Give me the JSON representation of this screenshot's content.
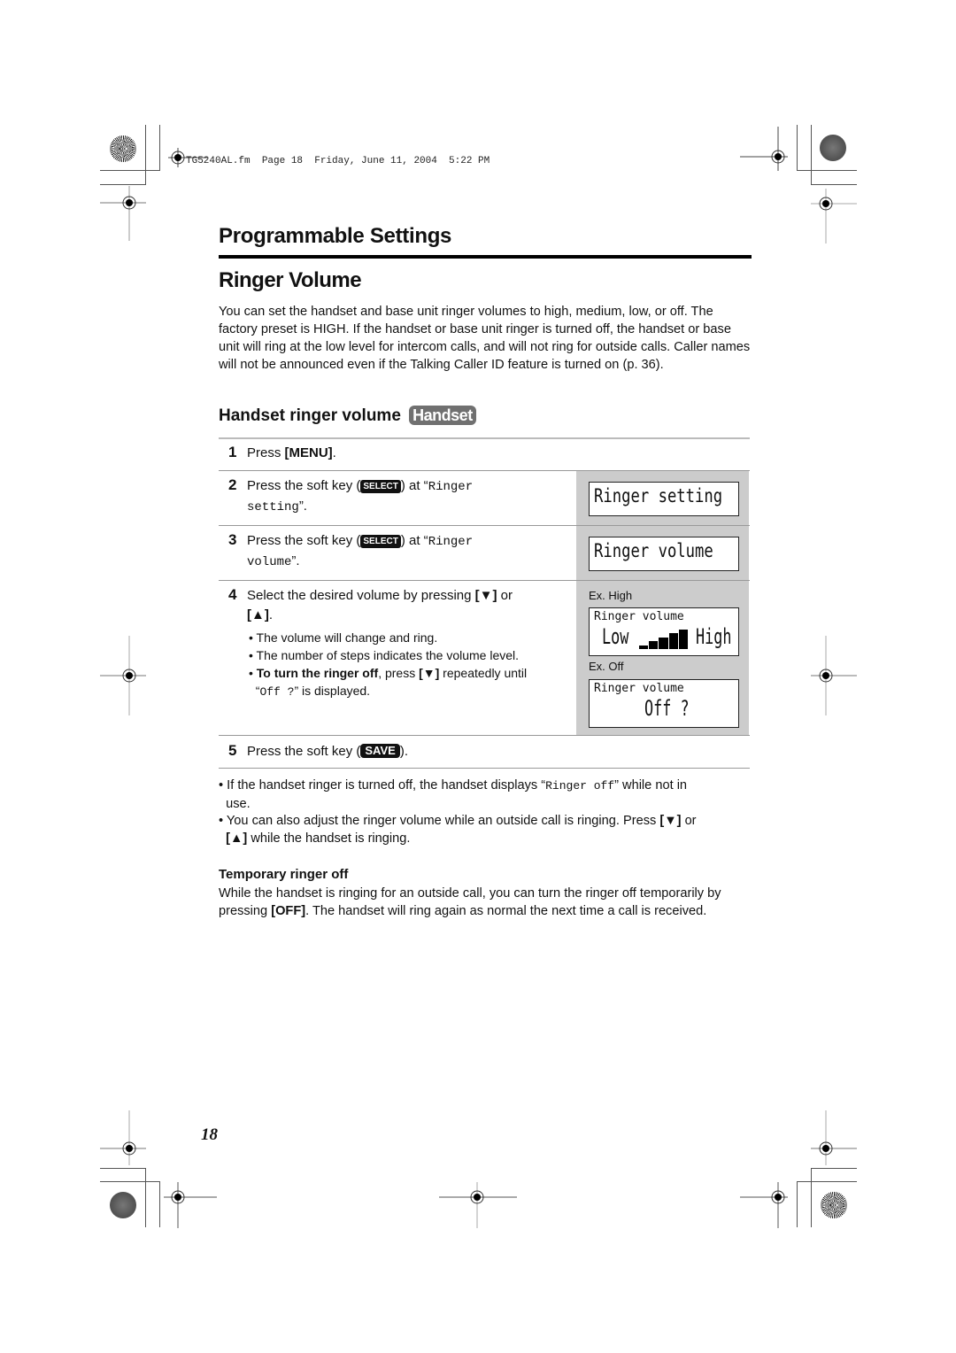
{
  "file_info": "TG5240AL.fm  Page 18  Friday, June 11, 2004  5:22 PM",
  "section_title": "Programmable Settings",
  "page_heading": "Ringer Volume",
  "intro": "You can set the handset and base unit ringer volumes to high, medium, low, or off. The factory preset is HIGH. If the handset or base unit ringer is turned off, the handset or base unit will ring at the low level for intercom calls, and will not ring for outside calls. Caller names will not be announced even if the Talking Caller ID feature is turned on (p. 36).",
  "subsection": {
    "title": "Handset ringer volume",
    "badge": "Handset"
  },
  "keys": {
    "menu": "[MENU]",
    "select": "SELECT",
    "save": "SAVE",
    "down": "[▼]",
    "up": "[▲]",
    "off": "[OFF]"
  },
  "steps": [
    {
      "num": "1",
      "text_before": "Press ",
      "key": "[MENU]",
      "text_after": "."
    },
    {
      "num": "2",
      "text_before": "Press the soft key (",
      "key": "SELECT",
      "text_mid": ") at “",
      "mono1": "Ringer",
      "mono2": "setting",
      "text_after": "”."
    },
    {
      "num": "3",
      "text_before": "Press the soft key (",
      "key": "SELECT",
      "text_mid": ") at “",
      "mono1": "Ringer",
      "mono2": "volume",
      "text_after": "”."
    },
    {
      "num": "4",
      "text_before": "Select the desired volume by pressing ",
      "text_or": " or",
      "text_after": "."
    },
    {
      "num": "5",
      "text_before": "Press the soft key (",
      "key": "SAVE",
      "text_after": ")."
    }
  ],
  "step4_bullets": {
    "b1": "The volume will change and ring.",
    "b2": "The number of steps indicates the volume level.",
    "b3_bold": "To turn the ringer off",
    "b3_mid": ", press ",
    "b3_after": " repeatedly until",
    "b3_line2_open": "“",
    "b3_mono": "Off ?",
    "b3_line2_close": "” is displayed."
  },
  "displays": {
    "d1": "Ringer setting",
    "d2": "Ringer volume",
    "ex_high_label": "Ex. High",
    "ex_high_line1": "Ringer volume",
    "ex_high_low": "Low",
    "ex_high_high": "High",
    "volume_level": 5,
    "volume_max": 5,
    "ex_off_label": "Ex. Off",
    "ex_off_line1": "Ringer volume",
    "ex_off_line2": "Off ?"
  },
  "notes": {
    "n1_before": "If the handset ringer is turned off, the handset displays “",
    "n1_mono": "Ringer off",
    "n1_after": "” while not in",
    "n1_line2": "use.",
    "n2_line1": "You can also adjust the ringer volume while an outside call is ringing. Press ",
    "n2_or": " or",
    "n2_line2": " while the handset is ringing."
  },
  "temporary": {
    "title": "Temporary ringer off",
    "before": "While the handset is ringing for an outside call, you can turn the ringer off temporarily by pressing ",
    "key": "[OFF]",
    "after": ". The handset will ring again as normal the next time a call is received."
  },
  "page_number": "18"
}
